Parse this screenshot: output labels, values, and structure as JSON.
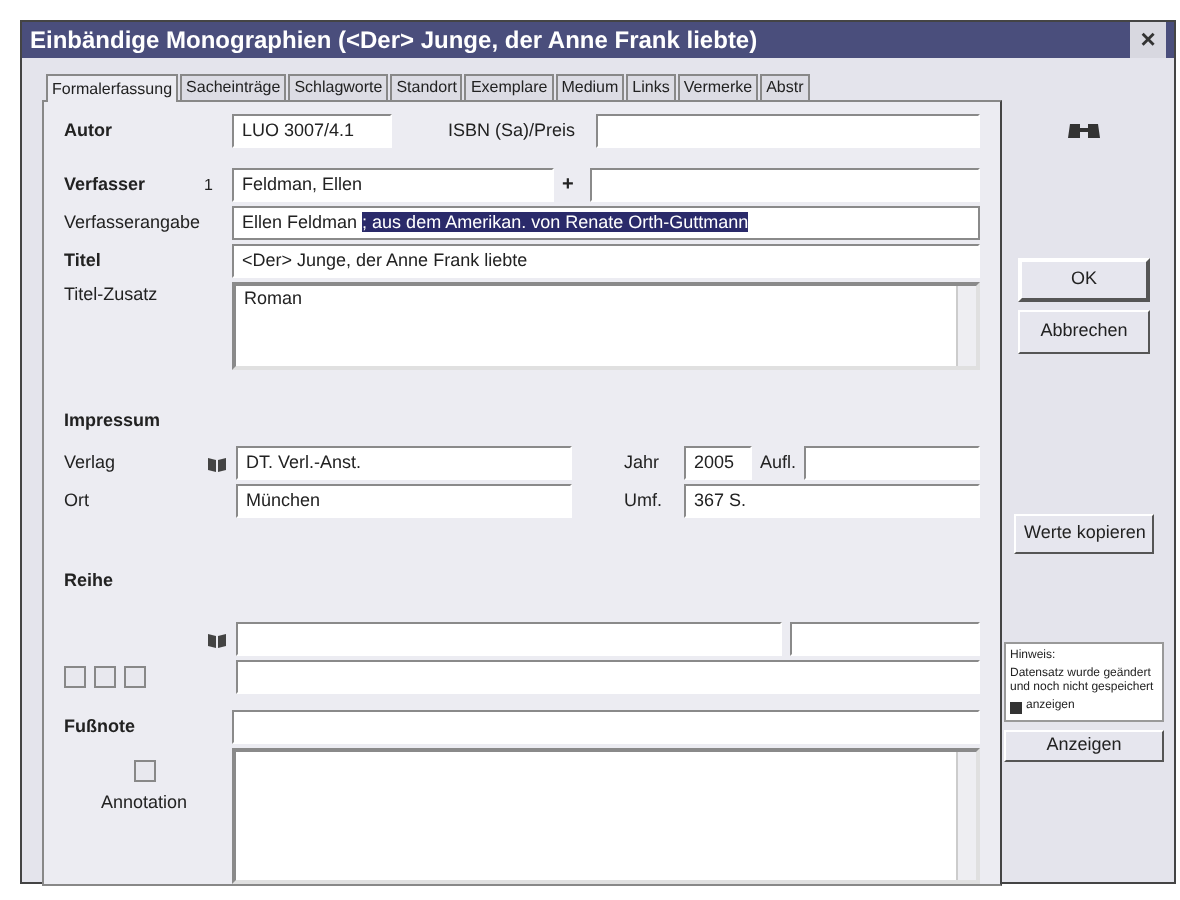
{
  "window": {
    "title": "Einbändige Monographien (<Der> Junge, der Anne Frank liebte)",
    "close": "×"
  },
  "tabs": [
    {
      "label": "Formalerfassung",
      "selected": true
    },
    {
      "label": "Sacheinträge",
      "selected": false
    },
    {
      "label": "Schlagworte",
      "selected": false
    },
    {
      "label": "Standort",
      "selected": false
    },
    {
      "label": "Exemplare",
      "selected": false
    },
    {
      "label": "Medium",
      "selected": false
    },
    {
      "label": "Links",
      "selected": false
    },
    {
      "label": "Vermerke",
      "selected": false
    },
    {
      "label": "Abstr",
      "selected": false
    }
  ],
  "record": {
    "signature_label": "Autor",
    "signature": "LUO 3007/4.1",
    "isbn_label": "ISBN (Sa)/Preis"
  },
  "author": {
    "label": "Verfasser",
    "marker": "1",
    "value": "Feldman, Ellen",
    "add": "+"
  },
  "statement": {
    "label": "Verfasserangabe",
    "value": "Ellen Feldman",
    "selected_value": "; aus dem Amerikan. von Renate Orth-Guttmann"
  },
  "title": {
    "label": "Titel",
    "value": "<Der> Junge, der Anne Frank liebte"
  },
  "subtitle": {
    "label": "Titel-Zusatz",
    "value": "Roman"
  },
  "imprint": {
    "heading": "Impressum",
    "publisher_label": "Verlag",
    "publisher": "DT. Verl.-Anst.",
    "place_label": "Ort",
    "place": "München",
    "year_label": "Jahr",
    "year": "2005",
    "edition_label": "Aufl.",
    "extent_label": "Umf.",
    "extent": "367 S."
  },
  "series": {
    "heading": "Reihe"
  },
  "footnote": {
    "label": "Fußnote"
  },
  "annotation": {
    "label": "Annotation"
  },
  "side": {
    "buttons": [
      "OK",
      "Abbrechen",
      "Werte kopieren"
    ],
    "note_title": "Hinweis:",
    "note_text": "Datensatz wurde geändert und noch nicht gespeichert",
    "note_check": "anzeigen",
    "note_checked": true,
    "show_button": "Anzeigen"
  }
}
